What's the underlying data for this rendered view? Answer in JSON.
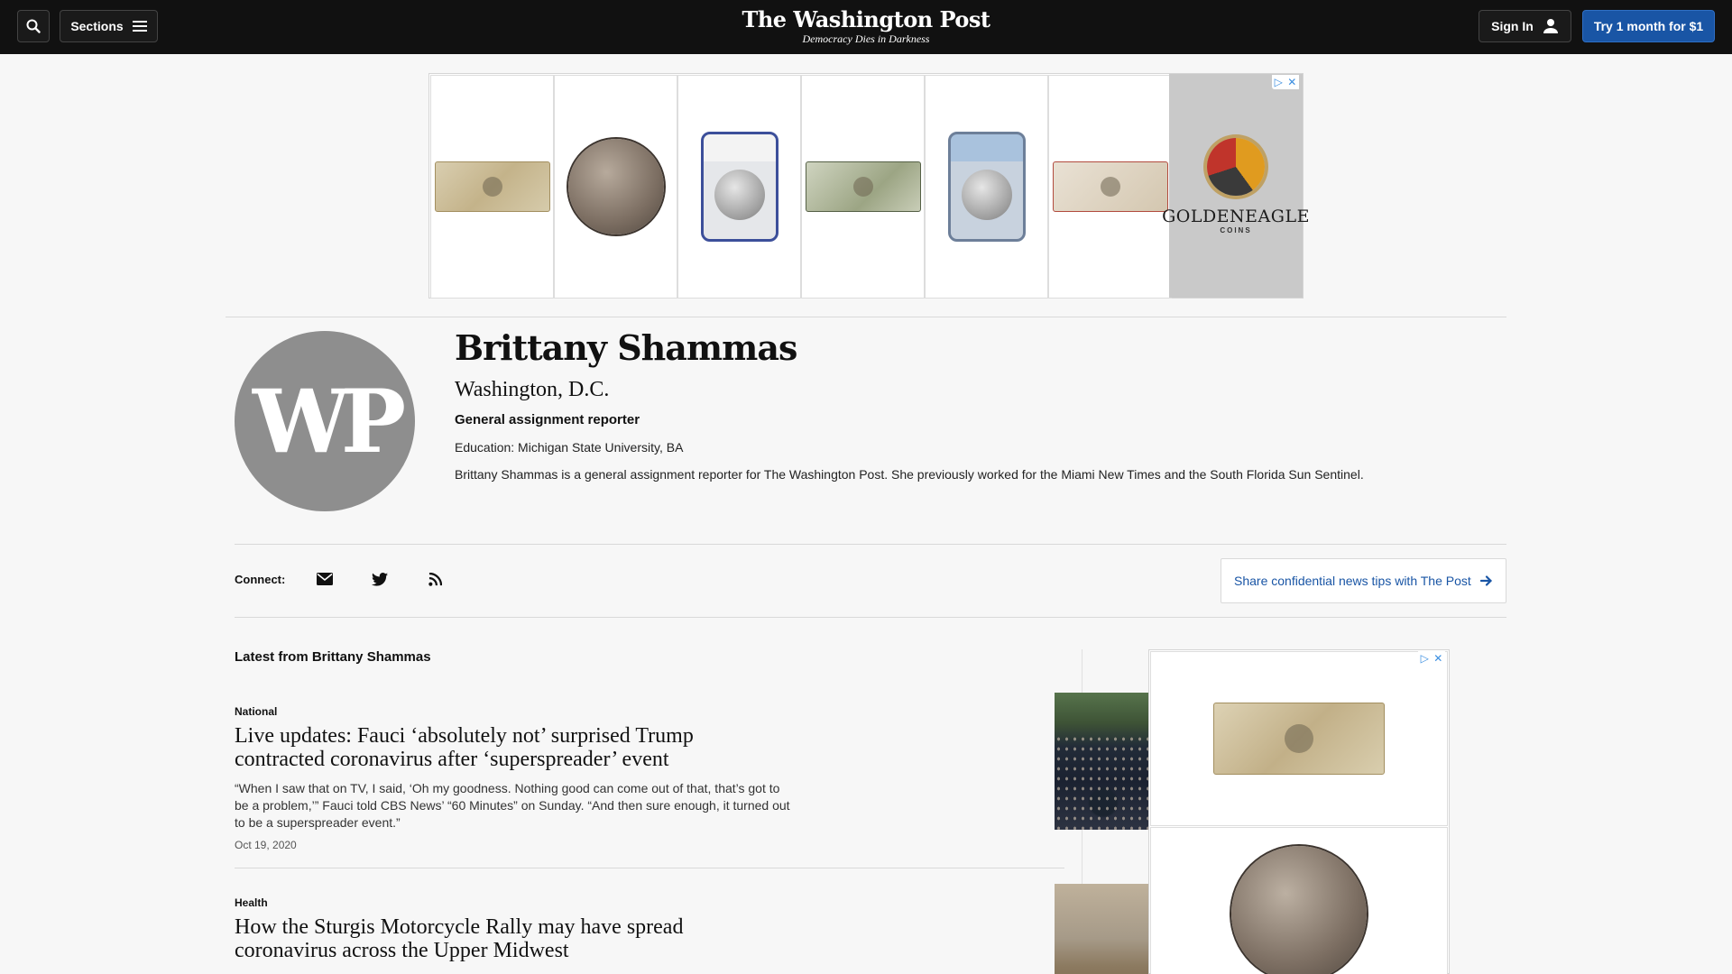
{
  "header": {
    "sections_label": "Sections",
    "masthead": "The Washington Post",
    "tagline": "Democracy Dies in Darkness",
    "signin_label": "Sign In",
    "subscribe_label": "Try 1 month for $1"
  },
  "top_ad": {
    "brand": "GOLDENEAGLE",
    "brand_sub": "COINS"
  },
  "author": {
    "name": "Brittany Shammas",
    "location": "Washington, D.C.",
    "title": "General assignment reporter",
    "education": "Education: Michigan State University, BA",
    "bio": "Brittany Shammas is a general assignment reporter for The Washington Post. She previously worked for the Miami New Times and the South Florida Sun Sentinel."
  },
  "connect": {
    "label": "Connect:",
    "icons": [
      "email-icon",
      "twitter-icon",
      "rss-icon"
    ],
    "tips_label": "Share confidential news tips with The Post"
  },
  "latest": {
    "heading": "Latest from Brittany Shammas",
    "stories": [
      {
        "kicker": "National",
        "headline": "Live updates: Fauci ‘absolutely not’ surprised Trump contracted coronavirus after ‘superspreader’ event",
        "blurb": "“When I saw that on TV, I said, ‘Oh my goodness. Nothing good can come out of that, that’s got to be a problem,’” Fauci told CBS News’ “60 Minutes” on Sunday. “And then sure enough, it turned out to be a superspreader event.”",
        "date": "Oct 19, 2020"
      },
      {
        "kicker": "Health",
        "headline": "How the Sturgis Motorcycle Rally may have spread coronavirus across the Upper Midwest"
      }
    ]
  },
  "colors": {
    "topbar": "#111111",
    "accent_blue": "#1955a5",
    "background": "#f7f7f7"
  }
}
